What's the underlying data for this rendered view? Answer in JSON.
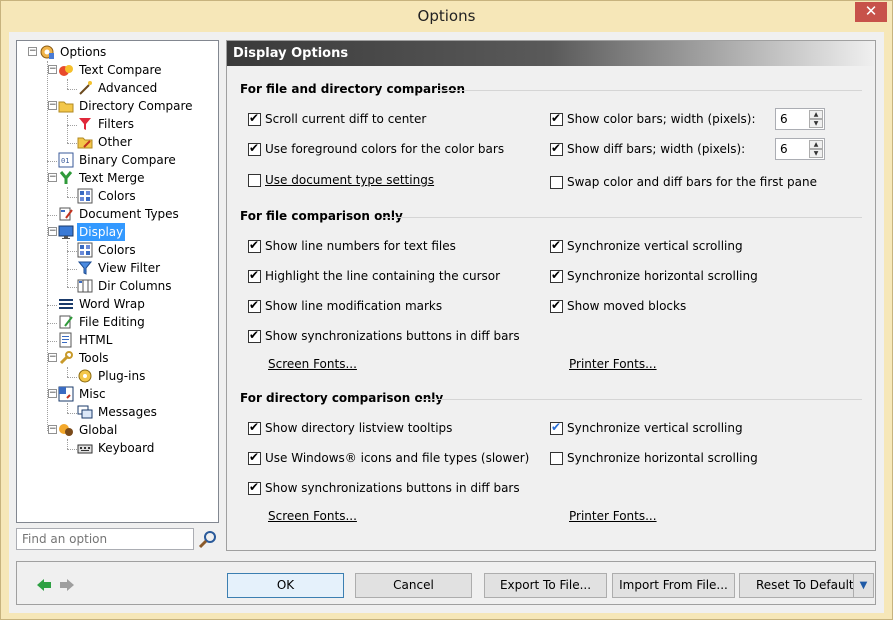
{
  "window": {
    "title": "Options",
    "close_label": "✕"
  },
  "tree": {
    "items": [
      {
        "label": "Options"
      },
      {
        "label": "Text Compare"
      },
      {
        "label": "Advanced"
      },
      {
        "label": "Directory Compare"
      },
      {
        "label": "Filters"
      },
      {
        "label": "Other"
      },
      {
        "label": "Binary Compare"
      },
      {
        "label": "Text Merge"
      },
      {
        "label": "Colors"
      },
      {
        "label": "Document Types"
      },
      {
        "label": "Display"
      },
      {
        "label": "Colors"
      },
      {
        "label": "View Filter"
      },
      {
        "label": "Dir Columns"
      },
      {
        "label": "Word Wrap"
      },
      {
        "label": "File Editing"
      },
      {
        "label": "HTML"
      },
      {
        "label": "Tools"
      },
      {
        "label": "Plug-ins"
      },
      {
        "label": "Misc"
      },
      {
        "label": "Messages"
      },
      {
        "label": "Global"
      },
      {
        "label": "Keyboard"
      }
    ],
    "selected": "Display"
  },
  "search": {
    "placeholder": "Find an option"
  },
  "panel": {
    "title": "Display Options",
    "sec1": {
      "title": "For file and directory comparison",
      "scroll_center": "Scroll current diff to center",
      "fg_colors": "Use foreground colors for the color bars",
      "doc_type": "Use document type settings",
      "color_bars": "Show color bars; width (pixels):",
      "color_bars_width": "6",
      "diff_bars": "Show diff bars; width (pixels):",
      "diff_bars_width": "6",
      "swap_bars": "Swap color and diff bars for the first pane"
    },
    "sec2": {
      "title": "For file comparison only",
      "line_numbers": "Show line numbers for text files",
      "highlight_line": "Highlight the line containing the cursor",
      "mod_marks": "Show line modification marks",
      "sync_buttons": "Show synchronizations buttons in diff bars",
      "sync_vert": "Synchronize vertical scrolling",
      "sync_horiz": "Synchronize horizontal scrolling",
      "moved_blocks": "Show moved blocks",
      "screen_fonts": "Screen Fonts...",
      "printer_fonts": "Printer Fonts..."
    },
    "sec3": {
      "title": "For directory comparison only",
      "listview_tooltips": "Show directory listview tooltips",
      "win_icons": "Use Windows® icons and file types (slower)",
      "sync_buttons": "Show synchronizations buttons in diff bars",
      "sync_vert": "Synchronize vertical scrolling",
      "sync_horiz": "Synchronize horizontal scrolling",
      "screen_fonts": "Screen Fonts...",
      "printer_fonts": "Printer Fonts..."
    }
  },
  "buttons": {
    "ok": "OK",
    "cancel": "Cancel",
    "export": "Export To File...",
    "import": "Import From File...",
    "reset": "Reset To Default"
  },
  "colors": {
    "selection": "#3399ff",
    "nav_back": "#2ea043",
    "nav_forward": "#9e9e9e"
  }
}
